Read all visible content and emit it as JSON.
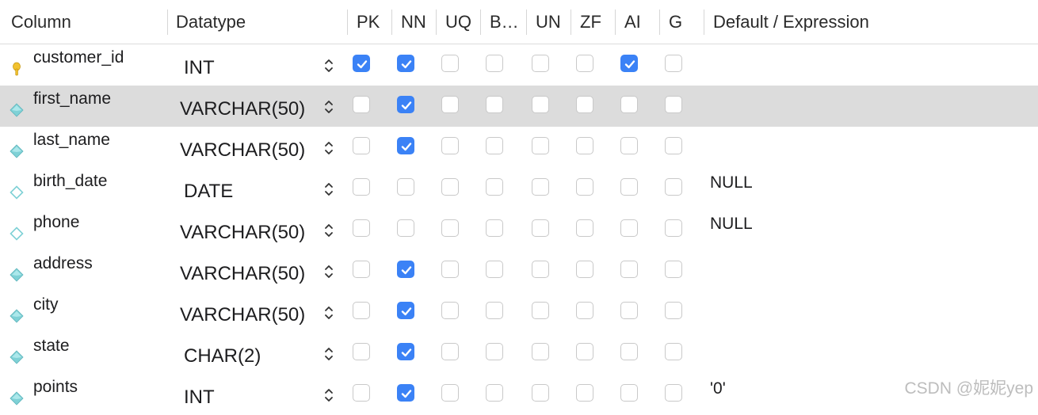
{
  "header": {
    "column": "Column",
    "datatype": "Datatype",
    "flags": [
      "PK",
      "NN",
      "UQ",
      "B…",
      "UN",
      "ZF",
      "AI",
      "G"
    ],
    "default": "Default / Expression"
  },
  "rows": [
    {
      "name": "customer_id",
      "icon": "primary-key-icon",
      "type": "INT",
      "flags": [
        true,
        true,
        false,
        false,
        false,
        false,
        true,
        false
      ],
      "default": ""
    },
    {
      "name": "first_name",
      "icon": "column-diamond-icon",
      "type": "VARCHAR(50)",
      "flags": [
        false,
        true,
        false,
        false,
        false,
        false,
        false,
        false
      ],
      "default": "",
      "selected": true
    },
    {
      "name": "last_name",
      "icon": "column-diamond-icon",
      "type": "VARCHAR(50)",
      "flags": [
        false,
        true,
        false,
        false,
        false,
        false,
        false,
        false
      ],
      "default": ""
    },
    {
      "name": "birth_date",
      "icon": "column-diamond-outline-icon",
      "type": "DATE",
      "flags": [
        false,
        false,
        false,
        false,
        false,
        false,
        false,
        false
      ],
      "default": "NULL"
    },
    {
      "name": "phone",
      "icon": "column-diamond-outline-icon",
      "type": "VARCHAR(50)",
      "flags": [
        false,
        false,
        false,
        false,
        false,
        false,
        false,
        false
      ],
      "default": "NULL"
    },
    {
      "name": "address",
      "icon": "column-diamond-icon",
      "type": "VARCHAR(50)",
      "flags": [
        false,
        true,
        false,
        false,
        false,
        false,
        false,
        false
      ],
      "default": ""
    },
    {
      "name": "city",
      "icon": "column-diamond-icon",
      "type": "VARCHAR(50)",
      "flags": [
        false,
        true,
        false,
        false,
        false,
        false,
        false,
        false
      ],
      "default": ""
    },
    {
      "name": "state",
      "icon": "column-diamond-icon",
      "type": "CHAR(2)",
      "flags": [
        false,
        true,
        false,
        false,
        false,
        false,
        false,
        false
      ],
      "default": ""
    },
    {
      "name": "points",
      "icon": "column-diamond-icon",
      "type": "INT",
      "flags": [
        false,
        true,
        false,
        false,
        false,
        false,
        false,
        false
      ],
      "default": "'0'"
    }
  ],
  "watermark": "CSDN @妮妮yep",
  "colors": {
    "checkbox_on": "#3b82f6",
    "selected_row": "#dcdcdc",
    "key_icon": "#f2c230",
    "diamond_icon": "#7fd1d6"
  }
}
